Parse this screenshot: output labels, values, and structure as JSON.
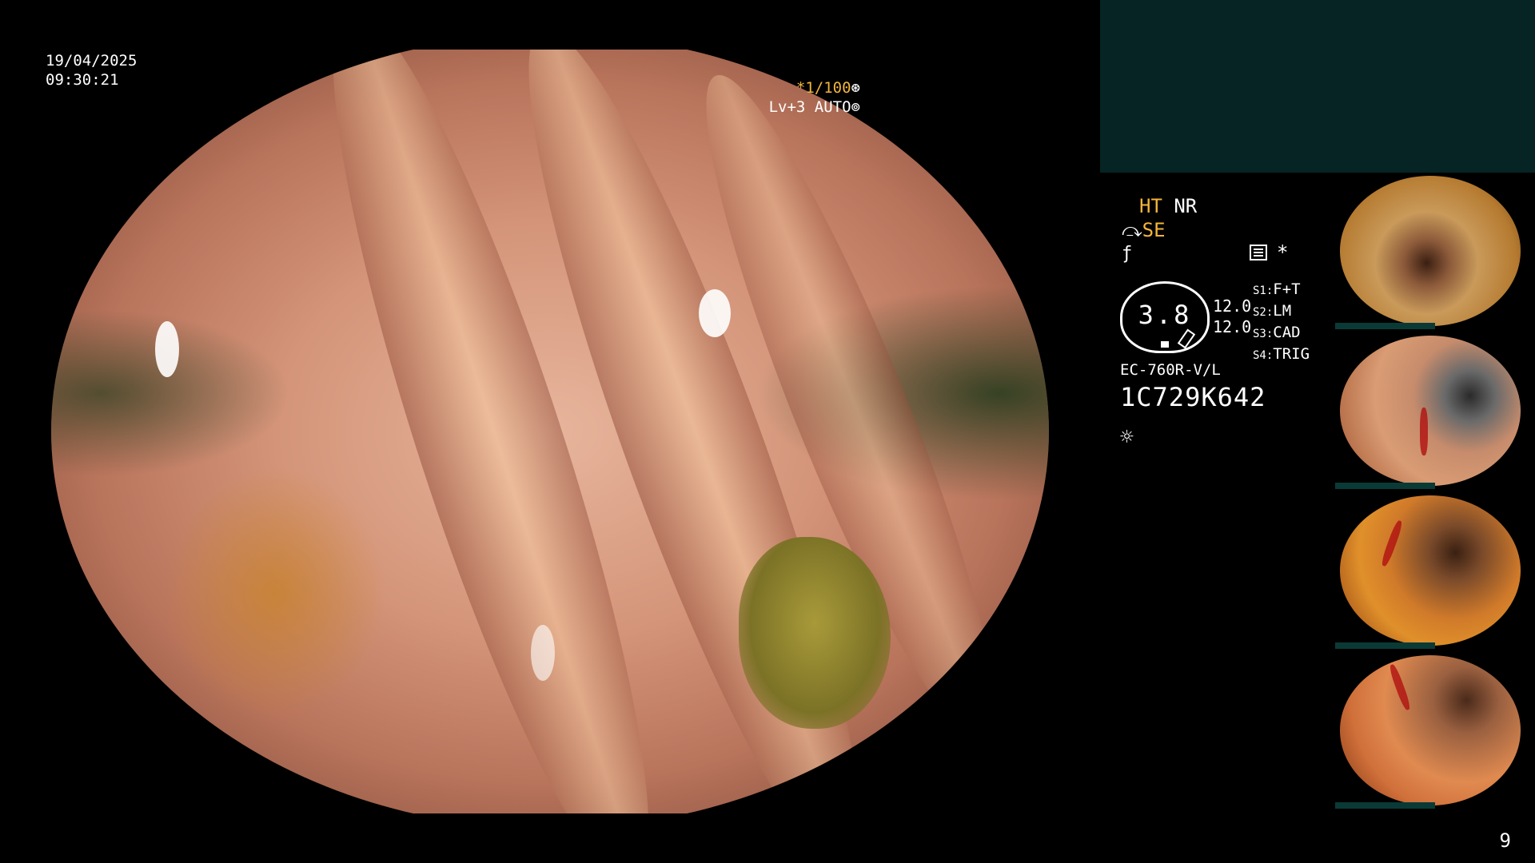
{
  "overlay": {
    "date": "19/04/2025",
    "time": "09:30:21",
    "shutter_prefix": "*",
    "shutter_speed": "1/100",
    "level_line": "Lv+3 AUTO"
  },
  "settings": {
    "ht": "HT",
    "nr": "NR",
    "se": "SE",
    "star": "*",
    "gauge_value": "3.8",
    "values": [
      "12.0",
      "12.0"
    ],
    "switches": [
      {
        "key": "S1:",
        "value": "F+T"
      },
      {
        "key": "S2:",
        "value": "LM"
      },
      {
        "key": "S3:",
        "value": "CAD"
      },
      {
        "key": "S4:",
        "value": "TRIG"
      }
    ],
    "scope_model": "EC-760R-V/L",
    "serial": "1C729K642"
  },
  "colors": {
    "accent": "#f3b53a",
    "panel_bg": "#062423",
    "background": "#000000",
    "text": "#ffffff"
  },
  "icons": [
    "shutter-icon",
    "auto-icon",
    "scissor-icon",
    "f-icon",
    "record-icon",
    "sun-icon"
  ],
  "thumbnails_count": 4,
  "page_number": "9"
}
